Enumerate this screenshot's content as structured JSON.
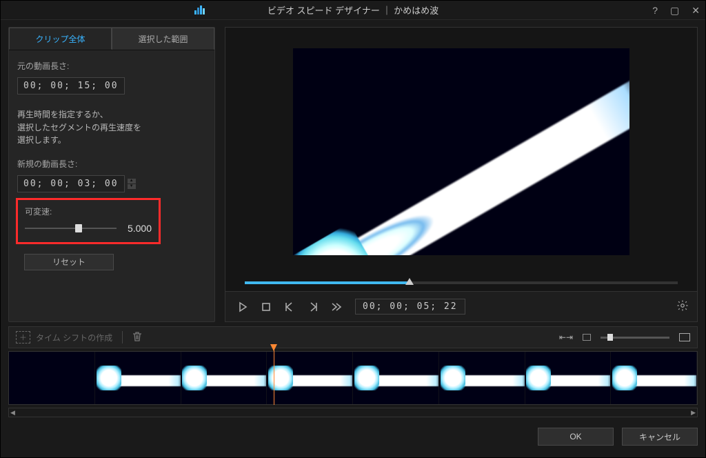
{
  "titlebar": {
    "title": "ビデオ スピード デザイナー  ｜  かめはめ波"
  },
  "tabs": {
    "entire": "クリップ全体",
    "range": "選択した範囲"
  },
  "panel": {
    "orig_label": "元の動画長さ:",
    "orig_value": "00; 00; 15; 00",
    "desc_l1": "再生時間を指定するか、",
    "desc_l2": "選択したセグメントの再生速度を",
    "desc_l3": "選択します。",
    "new_label": "新規の動画長さ:",
    "new_value": "00; 00; 03; 00",
    "speed_label": "可変速:",
    "speed_value": "5.000",
    "reset": "リセット"
  },
  "playback": {
    "time": "00; 00; 05; 22"
  },
  "timeline": {
    "create_shift": "タイム シフトの作成"
  },
  "footer": {
    "ok": "OK",
    "cancel": "キャンセル"
  }
}
